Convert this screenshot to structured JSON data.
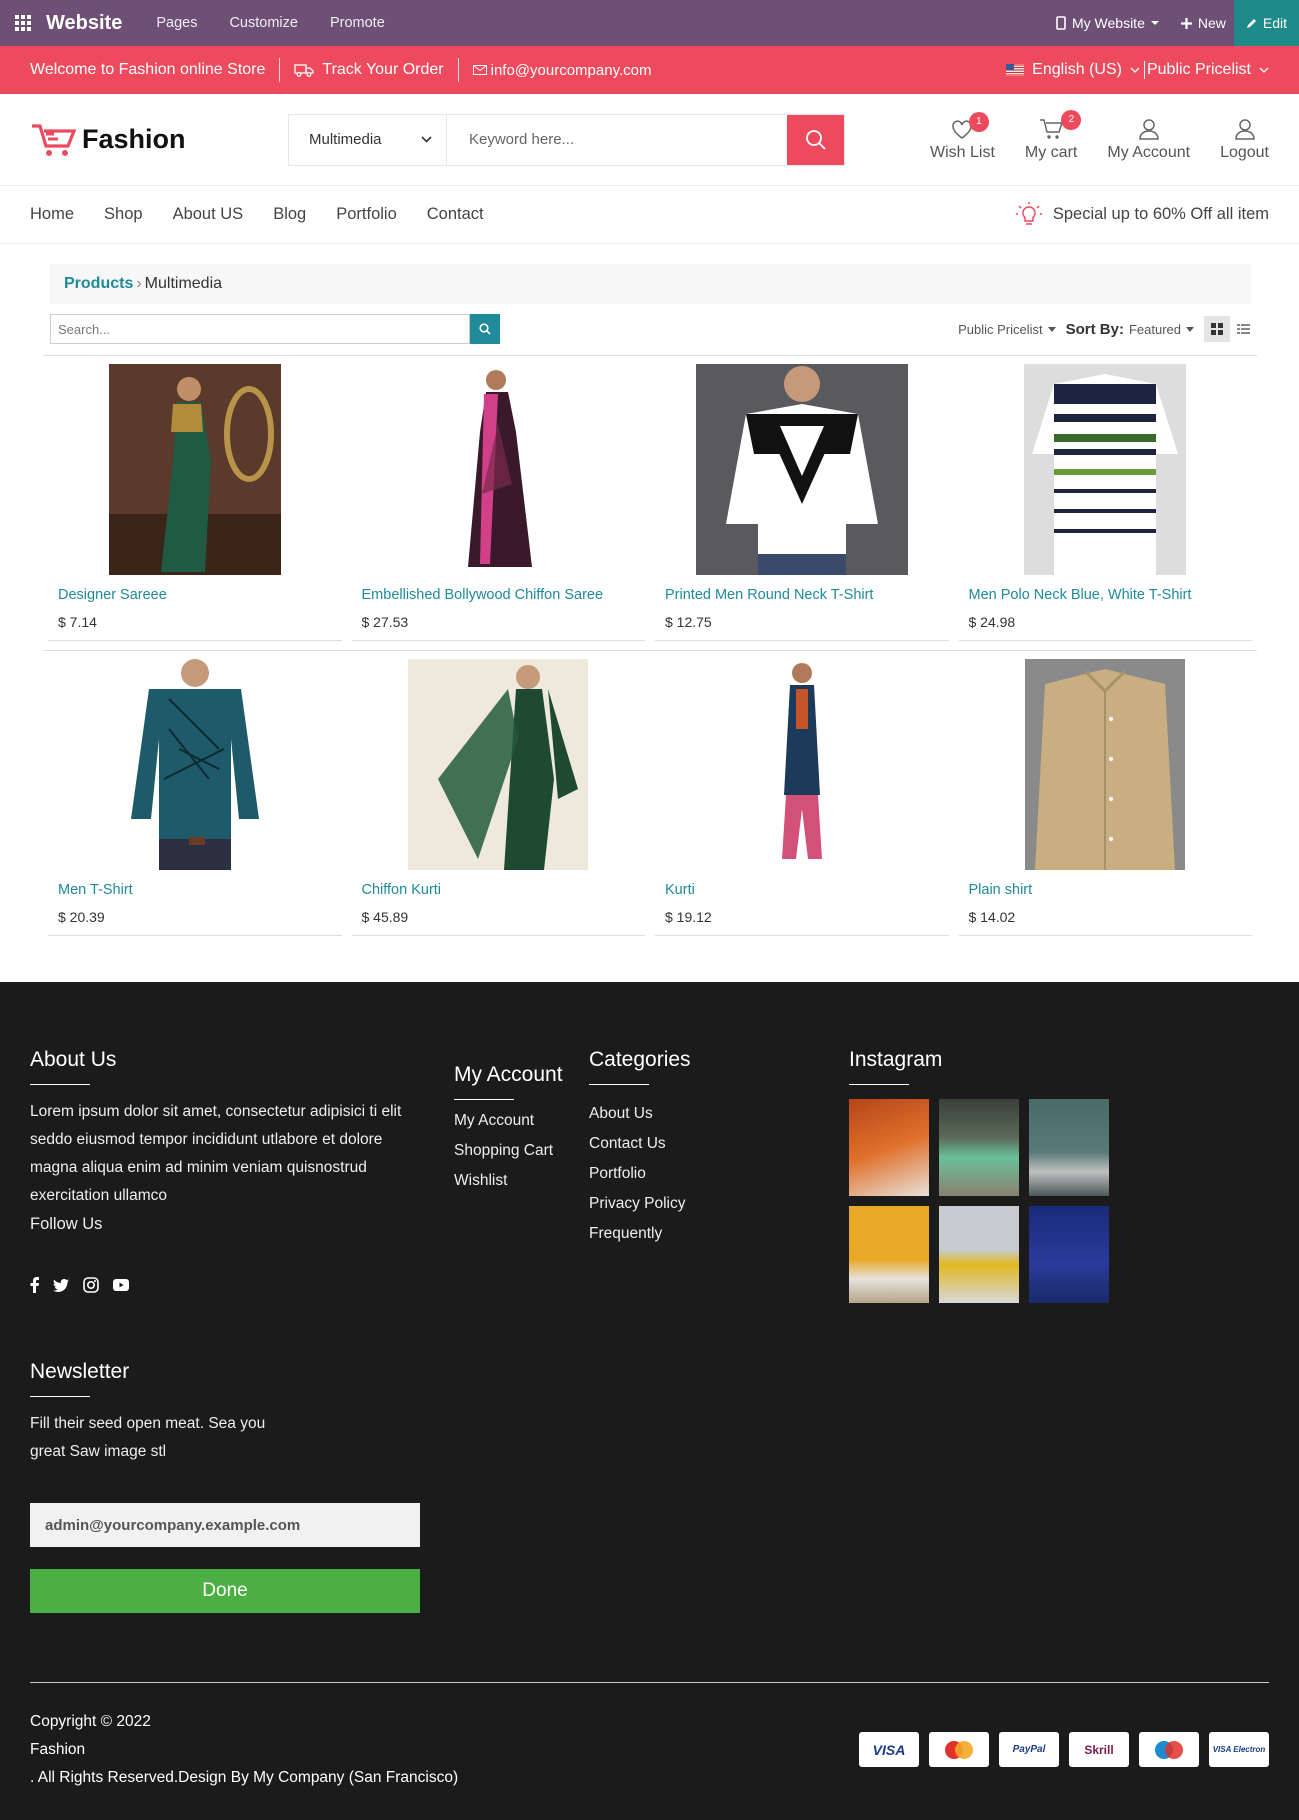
{
  "topbar": {
    "brand": "Website",
    "menus": [
      "Pages",
      "Customize",
      "Promote"
    ],
    "site": "My Website",
    "new": "New",
    "edit": "Edit"
  },
  "redbar": {
    "welcome": "Welcome to Fashion online Store",
    "track": "Track Your Order",
    "email": "info@yourcompany.com",
    "language": "English (US)",
    "pricelist": "Public Pricelist"
  },
  "header": {
    "logo": "Fashion",
    "category": "Multimedia",
    "search_placeholder": "Keyword here...",
    "wishlist": "Wish List",
    "wishlist_count": "1",
    "cart": "My cart",
    "cart_count": "2",
    "account": "My Account",
    "logout": "Logout"
  },
  "nav": {
    "items": [
      "Home",
      "Shop",
      "About US",
      "Blog",
      "Portfolio",
      "Contact"
    ],
    "promo": "Special up to 60% Off all item"
  },
  "breadcrumb": {
    "root": "Products",
    "current": "Multimedia"
  },
  "toolbar": {
    "search_placeholder": "Search...",
    "pricelist": "Public Pricelist",
    "sort_label": "Sort By:",
    "sort_value": "Featured"
  },
  "products": [
    {
      "name": "Designer Sareee",
      "price": "$ 7.14"
    },
    {
      "name": "Embellished Bollywood Chiffon Saree",
      "price": "$ 27.53"
    },
    {
      "name": "Printed Men Round Neck T-Shirt",
      "price": "$ 12.75"
    },
    {
      "name": "Men Polo Neck Blue, White T-Shirt",
      "price": "$ 24.98"
    },
    {
      "name": "Men T-Shirt",
      "price": "$ 20.39"
    },
    {
      "name": "Chiffon Kurti",
      "price": "$ 45.89"
    },
    {
      "name": "Kurti",
      "price": "$ 19.12"
    },
    {
      "name": "Plain shirt",
      "price": "$ 14.02"
    }
  ],
  "footer": {
    "about_title": "About Us",
    "about_text": "Lorem ipsum dolor sit amet, consectetur adipisici ti elit seddo eiusmod tempor incididunt utlabore et dolore magna aliqua enim ad minim veniam quisnostrud exercitation ullamco",
    "follow": "Follow Us",
    "account_title": "My Account",
    "account_links": [
      "My Account",
      "Shopping Cart",
      "Wishlist"
    ],
    "cat_title": "Categories",
    "cat_links": [
      "About Us",
      "Contact Us",
      "Portfolio",
      "Privacy Policy",
      "Frequently"
    ],
    "insta_title": "Instagram",
    "news_title": "Newsletter",
    "news_text1": "Fill their seed open meat. Sea you",
    "news_text2": "great Saw image stl",
    "news_email": "admin@yourcompany.example.com",
    "done": "Done",
    "copy1": "Copyright © 2022",
    "copy2": "Fashion",
    "copy3": ". All Rights Reserved.Design By My Company (San Francisco)",
    "payments": [
      "VISA",
      "MasterCard",
      "PayPal",
      "Skrill",
      "Maestro",
      "VISA Electron"
    ]
  }
}
